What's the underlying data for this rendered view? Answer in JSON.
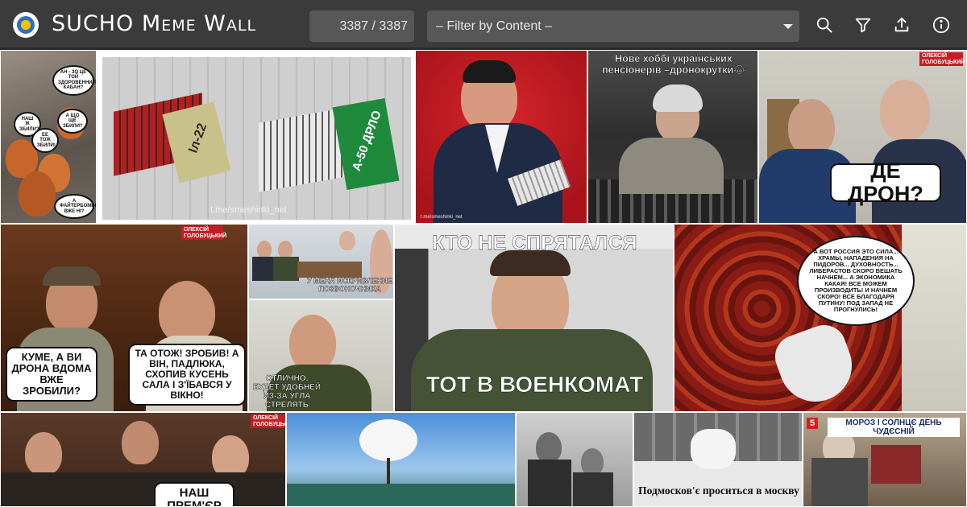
{
  "header": {
    "title": "SUCHO Meme Wall",
    "counter": "3387 / 3387",
    "filter_placeholder": "– Filter by Content –",
    "icons": [
      "logo-icon",
      "search-icon",
      "filter-icon",
      "upload-icon",
      "info-icon"
    ]
  },
  "colors": {
    "toolbar": "#3b3b3b",
    "field": "#575757",
    "text": "#ffffff"
  },
  "tiles": [
    {
      "id": "foxes",
      "bubbles": [
        "АН - ЗО ЦЕ ТОЙ ЗДОРОВЕННИЙ КАБАН?",
        "НАШ Ж ЗБИЛИ?",
        "А ЩО ЩЕ ЗБИЛИ?",
        "ЕЕ ТОЖ ЗБИЛИ!",
        "А ФАЙТЕРБОМБЕР ВЖЕ НІ?"
      ]
    },
    {
      "id": "accordions",
      "labels": [
        "Іл-22",
        "А-50 ДРЛО"
      ],
      "watermark": "t.me/smeshinki_net"
    },
    {
      "id": "singer",
      "watermark": "t.me/smeshinki_net"
    },
    {
      "id": "drone-granny",
      "caption": "Нове хоббі українських пенсіонерів –дронокрутки😂"
    },
    {
      "id": "where-drone",
      "caption": "ДЕ ДРОН?",
      "tag": "ОЛЕКСІЙ ГОЛОБУЦЬКИЙ"
    },
    {
      "id": "kume",
      "bubbles": [
        "КУМЕ, А ВИ ДРОНА ВДОМА ВЖЕ ЗРОБИЛИ?",
        "ТА ОТОЖ! ЗРОБИВ! А ВІН, ПАДЛЮКА, СХОПИВ КУСЕНЬ САЛА І З'ЇБАВСЯ У ВІКНО!"
      ],
      "tag": "ОЛЕКСІЙ ГОЛОБУЦЬКИЙ"
    },
    {
      "id": "office",
      "caption": "У МЕНЯ ИСКРИВЛЕНИЕ ПОЗВОНОЧНИКА"
    },
    {
      "id": "officer-small",
      "caption": "ОТЛИЧНО, БУДЕТ УДОБНЕЙ ИЗ-ЗА УГЛА СТРЕЛЯТЬ"
    },
    {
      "id": "voenkomat",
      "caption_top": "КТО НЕ СПРЯТАЛСЯ",
      "caption_bottom": "ТОТ В ВОЕНКОМАТ"
    },
    {
      "id": "carpet",
      "bubble": "А ВОТ РОССИЯ ЭТО СИЛА... ХРАМЫ, НАПАДЕНИЯ НА ПИДОРОВ... ДУХОВНОСТЬ... ЛИБЕРАСТОВ СКОРО ВЕШАТЬ НАЧНЕМ... А ЭКОНОМИКА КАКАЯ! ВСЕ МОЖЕМ ПРОИЗВОДИТЬ! И НАЧНЕМ СКОРО! ВСЕ БЛАГОДАРЯ ПУТИНУ! ПОД ЗАПАД НЕ ПРОГНУЛИСЬ!"
    },
    {
      "id": "holmes",
      "caption": "НАШ ПРЕМ'ЄР",
      "tag": "ОЛЕКСІЙ ГОЛОБУЦЬКИЙ"
    },
    {
      "id": "cotton"
    },
    {
      "id": "old-photo"
    },
    {
      "id": "moscow",
      "caption": "Подмосков'є проситься в москву"
    },
    {
      "id": "frost",
      "caption": "МОРОЗ І СОЛНЦЄ ДЕНЬ ЧУДЄСНІЙ",
      "channel": "5"
    }
  ]
}
